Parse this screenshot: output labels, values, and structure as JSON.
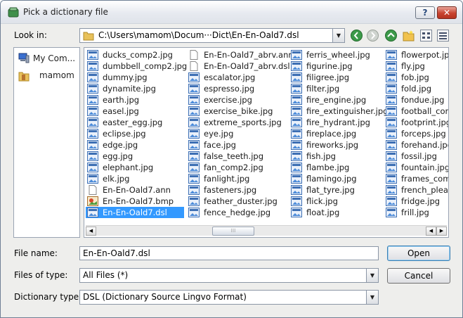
{
  "window": {
    "title": "Pick a dictionary file",
    "help_label": "?",
    "close_label": "✕"
  },
  "look_in": {
    "label": "Look in:",
    "path": "C:\\Users\\mamom\\Docum···Dict\\En-En-Oald7.dsl"
  },
  "places": [
    {
      "label": "My Com..."
    },
    {
      "label": "mamom"
    }
  ],
  "file_columns": [
    [
      {
        "name": "ducks_comp2.jpg",
        "type": "image"
      },
      {
        "name": "dumbbell_comp2.jpg",
        "type": "image"
      },
      {
        "name": "dummy.jpg",
        "type": "image"
      },
      {
        "name": "dynamite.jpg",
        "type": "image"
      },
      {
        "name": "earth.jpg",
        "type": "image"
      },
      {
        "name": "easel.jpg",
        "type": "image"
      },
      {
        "name": "easter_egg.jpg",
        "type": "image"
      },
      {
        "name": "eclipse.jpg",
        "type": "image"
      },
      {
        "name": "edge.jpg",
        "type": "image"
      },
      {
        "name": "egg.jpg",
        "type": "image"
      },
      {
        "name": "elephant.jpg",
        "type": "image"
      },
      {
        "name": "elk.jpg",
        "type": "image"
      },
      {
        "name": "En-En-Oald7.ann",
        "type": "doc"
      },
      {
        "name": "En-En-Oald7.bmp",
        "type": "bmp"
      },
      {
        "name": "En-En-Oald7.dsl",
        "type": "image",
        "selected": true
      }
    ],
    [
      {
        "name": "En-En-Oald7_abrv.ann",
        "type": "doc"
      },
      {
        "name": "En-En-Oald7_abrv.dsl",
        "type": "doc"
      },
      {
        "name": "escalator.jpg",
        "type": "image"
      },
      {
        "name": "espresso.jpg",
        "type": "image"
      },
      {
        "name": "exercise.jpg",
        "type": "image"
      },
      {
        "name": "exercise_bike.jpg",
        "type": "image"
      },
      {
        "name": "extreme_sports.jpg",
        "type": "image"
      },
      {
        "name": "eye.jpg",
        "type": "image"
      },
      {
        "name": "face.jpg",
        "type": "image"
      },
      {
        "name": "false_teeth.jpg",
        "type": "image"
      },
      {
        "name": "fan_comp2.jpg",
        "type": "image"
      },
      {
        "name": "fanlight.jpg",
        "type": "image"
      },
      {
        "name": "fasteners.jpg",
        "type": "image"
      },
      {
        "name": "feather_duster.jpg",
        "type": "image"
      },
      {
        "name": "fence_hedge.jpg",
        "type": "image"
      }
    ],
    [
      {
        "name": "ferris_wheel.jpg",
        "type": "image"
      },
      {
        "name": "figurine.jpg",
        "type": "image"
      },
      {
        "name": "filigree.jpg",
        "type": "image"
      },
      {
        "name": "filter.jpg",
        "type": "image"
      },
      {
        "name": "fire_engine.jpg",
        "type": "image"
      },
      {
        "name": "fire_extinguisher.jpg",
        "type": "image"
      },
      {
        "name": "fire_hydrant.jpg",
        "type": "image"
      },
      {
        "name": "fireplace.jpg",
        "type": "image"
      },
      {
        "name": "fireworks.jpg",
        "type": "image"
      },
      {
        "name": "fish.jpg",
        "type": "image"
      },
      {
        "name": "flambe.jpg",
        "type": "image"
      },
      {
        "name": "flamingo.jpg",
        "type": "image"
      },
      {
        "name": "flat_tyre.jpg",
        "type": "image"
      },
      {
        "name": "flick.jpg",
        "type": "image"
      },
      {
        "name": "float.jpg",
        "type": "image"
      }
    ],
    [
      {
        "name": "flowerpot.jpg",
        "type": "image"
      },
      {
        "name": "fly.jpg",
        "type": "image"
      },
      {
        "name": "fob.jpg",
        "type": "image"
      },
      {
        "name": "fold.jpg",
        "type": "image"
      },
      {
        "name": "fondue.jpg",
        "type": "image"
      },
      {
        "name": "football_com",
        "type": "image"
      },
      {
        "name": "footprint.jpg",
        "type": "image"
      },
      {
        "name": "forceps.jpg",
        "type": "image"
      },
      {
        "name": "forehand.jpg",
        "type": "image"
      },
      {
        "name": "fossil.jpg",
        "type": "image"
      },
      {
        "name": "fountain.jpg",
        "type": "image"
      },
      {
        "name": "frames_comp",
        "type": "image"
      },
      {
        "name": "french_pleat_",
        "type": "image"
      },
      {
        "name": "fridge.jpg",
        "type": "image"
      },
      {
        "name": "frill.jpg",
        "type": "image"
      }
    ]
  ],
  "file_name": {
    "label": "File name:",
    "value": "En-En-Oald7.dsl"
  },
  "files_of_type": {
    "label": "Files of type:",
    "value": "All Files (*)"
  },
  "dictionary_type": {
    "label": "Dictionary type:",
    "value": "DSL (Dictionary Source Lingvo Format)"
  },
  "buttons": {
    "open": "Open",
    "cancel": "Cancel"
  },
  "colors": {
    "selection": "#3399ff",
    "accent": "#3c7fb1"
  }
}
